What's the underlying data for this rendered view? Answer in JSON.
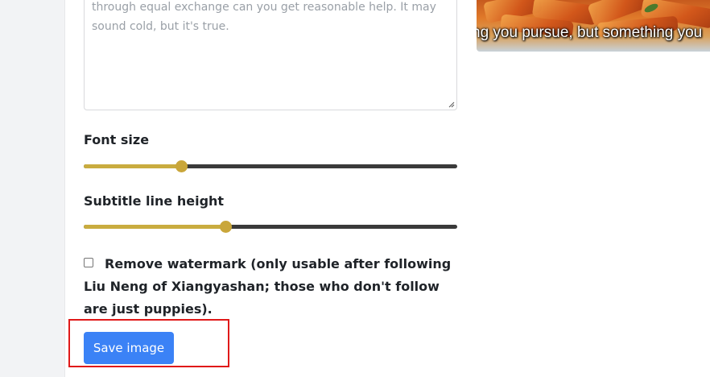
{
  "editor": {
    "text_lines": [
      "through equal exchange can you get reasonable help. It may",
      "sound cold, but it's true."
    ],
    "font_size_label": "Font size",
    "font_size_value": 0.26,
    "line_height_label": "Subtitle line height",
    "line_height_value": 0.38,
    "watermark_label": "Remove watermark (only usable after following Liu Neng of Xiangyashan; those who don't follow are just puppies).",
    "save_label": "Save image"
  },
  "preview": {
    "subtitle": "ng you pursue, but something you"
  },
  "colors": {
    "accent": "#c9a63a",
    "button": "#3b82f6",
    "highlight": "#e01919"
  }
}
